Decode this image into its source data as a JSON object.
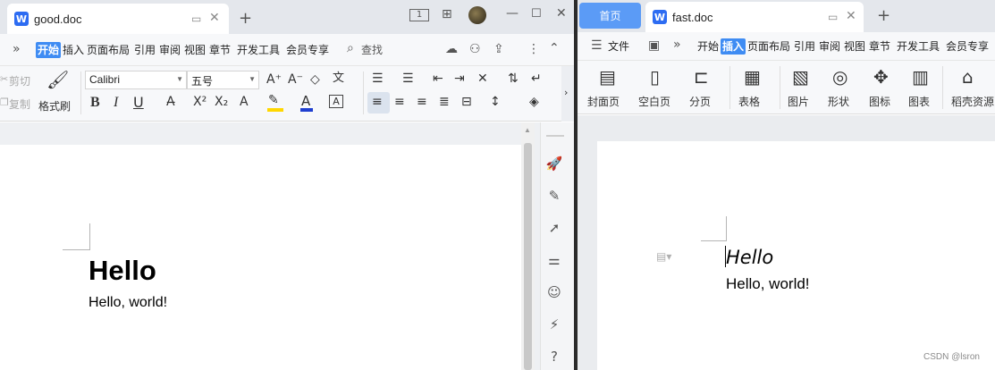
{
  "left_window": {
    "tab": {
      "title": "good.doc",
      "icon": "W"
    },
    "titlebar": {
      "view_badge": "1"
    },
    "menu": {
      "items": [
        "开始",
        "插入",
        "页面布局",
        "引用",
        "审阅",
        "视图",
        "章节",
        "开发工具",
        "会员专享"
      ],
      "active": "开始",
      "search": "查找"
    },
    "ribbon": {
      "cut": "剪切",
      "copy": "复制",
      "format_painter": "格式刷",
      "font_name": "Calibri",
      "font_size": "五号",
      "bold": "B",
      "italic": "I",
      "underline": "U",
      "superscript": "X²",
      "subscript": "X₂",
      "font_color": "A",
      "char_border": "A"
    },
    "document": {
      "heading": "Hello",
      "body": "Hello, world!"
    }
  },
  "right_window": {
    "home_tab": "首页",
    "tab": {
      "title": "fast.doc",
      "icon": "W"
    },
    "menu": {
      "file": "文件",
      "items": [
        "开始",
        "插入",
        "页面布局",
        "引用",
        "审阅",
        "视图",
        "章节",
        "开发工具",
        "会员专享"
      ],
      "active": "插入"
    },
    "ribbon": {
      "cover_page": "封面页",
      "blank_page": "空白页",
      "page_break": "分页",
      "table": "表格",
      "picture": "图片",
      "shapes": "形状",
      "icons": "图标",
      "chart": "图表",
      "docer_resources": "稻壳资源"
    },
    "document": {
      "heading": "Hello",
      "body": "Hello, world!"
    },
    "watermark": "CSDN @lsron"
  },
  "colors": {
    "accent": "#2d6cf2",
    "active_menu": "#3f8cf3",
    "home_tab": "#5b9bf6",
    "highlight": "#ffd700",
    "font_color_bar": "#1f3fd0"
  },
  "icons": [
    "close-icon",
    "plus-icon",
    "minimize-icon",
    "maximize-icon",
    "cloud-icon",
    "share-icon",
    "search-icon",
    "rocket-icon",
    "pen-icon",
    "pointer-icon",
    "sliders-icon",
    "robot-icon",
    "lightning-icon",
    "help-icon"
  ]
}
